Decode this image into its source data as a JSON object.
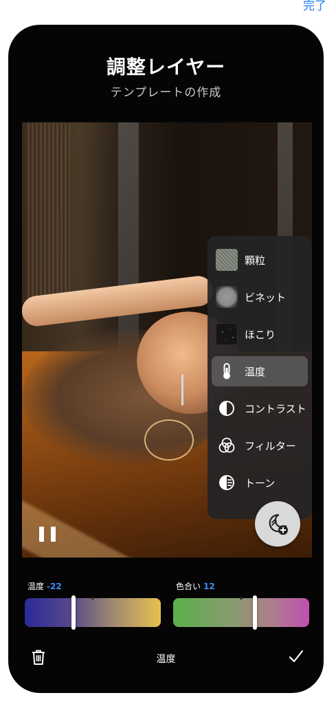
{
  "nav": {
    "done_label": "完了"
  },
  "header": {
    "title": "調整レイヤー",
    "subtitle": "テンプレートの作成"
  },
  "menu": {
    "items": [
      {
        "label": "顆粒",
        "icon": "grain-thumbnail"
      },
      {
        "label": "ビネット",
        "icon": "vignette-thumbnail"
      },
      {
        "label": "ほこり",
        "icon": "dust-thumbnail"
      },
      {
        "label": "温度",
        "icon": "thermometer-icon",
        "active": true
      },
      {
        "label": "コントラスト",
        "icon": "contrast-icon"
      },
      {
        "label": "フィルター",
        "icon": "filter-circles-icon"
      },
      {
        "label": "トーン",
        "icon": "tone-icon"
      }
    ]
  },
  "sliders": {
    "temperature": {
      "label": "温度",
      "value": "-22",
      "position": 0.36
    },
    "tint": {
      "label": "色合い",
      "value": "12",
      "position": 0.6
    }
  },
  "bottom": {
    "title": "温度"
  },
  "colors": {
    "accent": "#3d8cff",
    "done_link": "#1f7cf5",
    "background": "#050505",
    "menu": "#242426"
  }
}
